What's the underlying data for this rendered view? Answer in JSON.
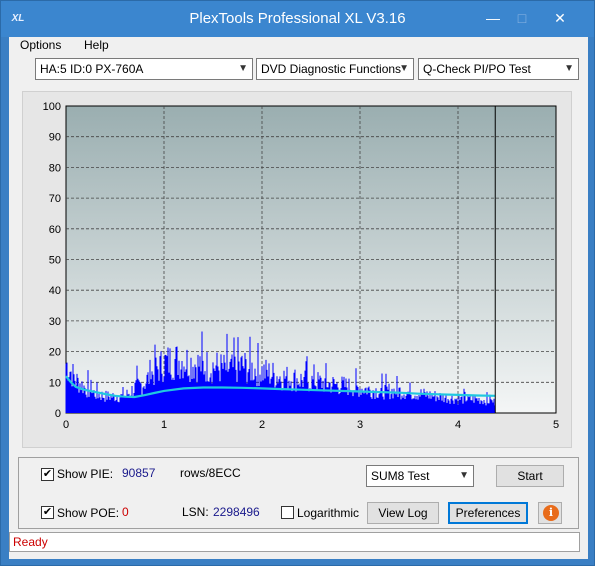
{
  "window": {
    "title": "PlexTools Professional XL V3.16",
    "icon_text": "XL",
    "minimize_glyph": "—",
    "maximize_glyph": "□",
    "close_glyph": "✕"
  },
  "menu": {
    "options": "Options",
    "help": "Help"
  },
  "toolbar": {
    "drive": "HA:5 ID:0  PX-760A",
    "function": "DVD Diagnostic Functions",
    "test": "Q-Check PI/PO Test"
  },
  "chart_data": {
    "type": "area",
    "title": "",
    "xlabel": "",
    "ylabel": "",
    "xlim": [
      0,
      5
    ],
    "ylim": [
      0,
      100
    ],
    "x_ticks": [
      "0",
      "1",
      "2",
      "3",
      "4",
      "5"
    ],
    "y_ticks": [
      "0",
      "10",
      "20",
      "30",
      "40",
      "50",
      "60",
      "70",
      "80",
      "90",
      "100"
    ],
    "grid": true,
    "end_marker_x": 4.38,
    "series": [
      {
        "name": "",
        "kind": "PIE bars",
        "color": "#0000ff",
        "x": [
          0,
          0.05,
          0.1,
          0.2,
          0.3,
          0.4,
          0.5,
          0.6,
          0.7,
          0.8,
          0.9,
          1.0,
          1.1,
          1.2,
          1.3,
          1.4,
          1.5,
          1.6,
          1.7,
          1.8,
          1.9,
          2.0,
          2.2,
          2.4,
          2.6,
          2.8,
          3.0,
          3.2,
          3.4,
          3.6,
          3.8,
          4.0,
          4.2,
          4.38
        ],
        "y": [
          18,
          15,
          12,
          9,
          7,
          6,
          6,
          6,
          9,
          11,
          15,
          18,
          19,
          19,
          18,
          17,
          17,
          16,
          16,
          17,
          16,
          15,
          13,
          12,
          11,
          10,
          9,
          8,
          8,
          7,
          6,
          5,
          5,
          4
        ]
      },
      {
        "name": "",
        "kind": "PIE average line",
        "color": "#20c8e0",
        "x": [
          0,
          0.05,
          0.1,
          0.2,
          0.3,
          0.4,
          0.5,
          0.6,
          0.7,
          0.8,
          0.9,
          1.0,
          1.2,
          1.4,
          1.6,
          1.8,
          2.0,
          2.2,
          2.4,
          2.6,
          2.8,
          3.0,
          3.2,
          3.4,
          3.6,
          3.8,
          4.0,
          4.2,
          4.38
        ],
        "y": [
          12,
          10,
          8.5,
          7.5,
          6.8,
          6.2,
          5.6,
          5.3,
          5.2,
          5.8,
          6.5,
          7.2,
          8,
          8.3,
          8.3,
          8.2,
          8,
          7.8,
          7.6,
          7.4,
          7.2,
          7,
          6.8,
          6.6,
          6.3,
          6.1,
          5.9,
          5.7,
          5.6
        ]
      }
    ]
  },
  "controls": {
    "show_pie_label": "Show PIE:",
    "show_pie_checked": true,
    "pie_value": "90857",
    "pie_unit": "rows/8ECC",
    "show_poe_label": "Show POE:",
    "show_poe_checked": true,
    "poe_value": "0",
    "lsn_label": "LSN:",
    "lsn_value": "2298496",
    "logarithmic_label": "Logarithmic",
    "logarithmic_checked": false,
    "sum_select": "SUM8 Test",
    "start_button": "Start",
    "view_log_button": "View Log",
    "preferences_button": "Preferences",
    "info_glyph": "i",
    "check_glyph": "✔"
  },
  "status": {
    "text": "Ready"
  },
  "colors": {
    "plot_bg_top": "#9aaeb0",
    "plot_bg_bottom": "#f4f6f6",
    "bars": "#0000ff",
    "avg_line": "#20c8e0",
    "status_text": "#cc0000"
  }
}
